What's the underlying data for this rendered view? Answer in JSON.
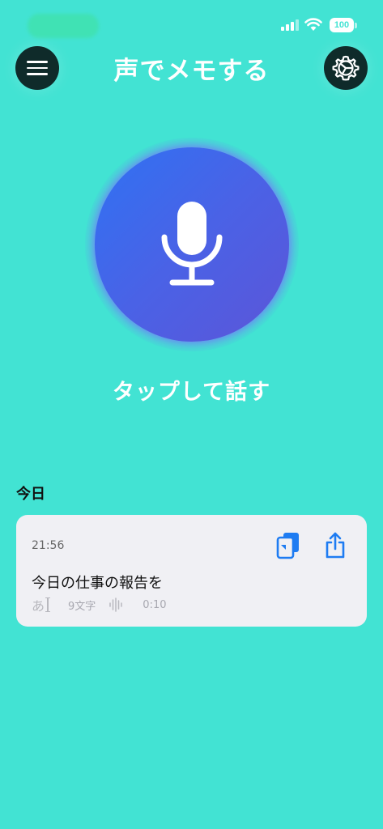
{
  "status_bar": {
    "battery_level": "100",
    "battery_color": "#ffffff"
  },
  "header": {
    "title": "声でメモする",
    "menu_icon": "hamburger-menu-icon",
    "settings_icon": "gear-icon"
  },
  "recorder": {
    "mic_icon": "microphone-icon",
    "tap_label": "タップして話す",
    "gradient_start": "#2f72f3",
    "gradient_end": "#5c55d8"
  },
  "history": {
    "section_title": "今日",
    "memos": [
      {
        "time": "21:56",
        "text": "今日の仕事の報告を",
        "input_glyph": "あ",
        "char_count": "9文字",
        "duration": "0:10",
        "copy_icon": "copy-icon",
        "share_icon": "share-icon"
      }
    ]
  },
  "colors": {
    "background": "#42e3d3",
    "accent_blue": "#1e7cf2",
    "dark_button": "#0f2b2a",
    "card": "#f0f0f4"
  }
}
